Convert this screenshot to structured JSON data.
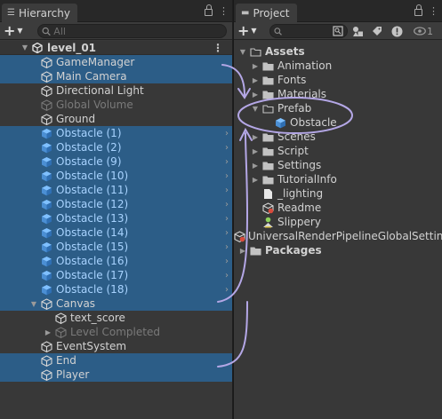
{
  "hierarchy": {
    "tab_label": "Hierarchy",
    "tab_menu": "⋮",
    "search_placeholder": "All",
    "scene_name": "level_01",
    "items": [
      {
        "label": "GameManager",
        "kind": "go",
        "selected": true
      },
      {
        "label": "Main Camera",
        "kind": "go",
        "selected": true
      },
      {
        "label": "Directional Light",
        "kind": "go",
        "selected": false
      },
      {
        "label": "Global Volume",
        "kind": "go",
        "selected": false,
        "dim": true
      },
      {
        "label": "Ground",
        "kind": "go",
        "selected": false
      },
      {
        "label": "Obstacle (1)",
        "kind": "prefab",
        "selected": true
      },
      {
        "label": "Obstacle (2)",
        "kind": "prefab",
        "selected": true
      },
      {
        "label": "Obstacle (9)",
        "kind": "prefab",
        "selected": true
      },
      {
        "label": "Obstacle (10)",
        "kind": "prefab",
        "selected": true
      },
      {
        "label": "Obstacle (11)",
        "kind": "prefab",
        "selected": true
      },
      {
        "label": "Obstacle (12)",
        "kind": "prefab",
        "selected": true
      },
      {
        "label": "Obstacle (13)",
        "kind": "prefab",
        "selected": true
      },
      {
        "label": "Obstacle (14)",
        "kind": "prefab",
        "selected": true
      },
      {
        "label": "Obstacle (15)",
        "kind": "prefab",
        "selected": true
      },
      {
        "label": "Obstacle (16)",
        "kind": "prefab",
        "selected": true
      },
      {
        "label": "Obstacle (17)",
        "kind": "prefab",
        "selected": true
      },
      {
        "label": "Obstacle (18)",
        "kind": "prefab",
        "selected": true
      },
      {
        "label": "Canvas",
        "kind": "go",
        "selected": true,
        "expanded": true
      },
      {
        "label": "text_score",
        "kind": "go",
        "selected": false,
        "child": true
      },
      {
        "label": "Level Completed",
        "kind": "go",
        "selected": false,
        "child": true,
        "dim": true,
        "collapsed": true
      },
      {
        "label": "EventSystem",
        "kind": "go",
        "selected": false
      },
      {
        "label": "End",
        "kind": "go",
        "selected": true
      },
      {
        "label": "Player",
        "kind": "go",
        "selected": true
      }
    ]
  },
  "project": {
    "tab_label": "Project",
    "tab_menu": "⋮",
    "badge": "1",
    "tree": [
      {
        "label": "Assets",
        "level": 0,
        "type": "folder-open",
        "bold": true
      },
      {
        "label": "Animation",
        "level": 1,
        "type": "folder"
      },
      {
        "label": "Fonts",
        "level": 1,
        "type": "folder"
      },
      {
        "label": "Materials",
        "level": 1,
        "type": "folder"
      },
      {
        "label": "Prefab",
        "level": 1,
        "type": "folder-open",
        "expanded": true
      },
      {
        "label": "Obstacle",
        "level": 2,
        "type": "prefab"
      },
      {
        "label": "Scenes",
        "level": 1,
        "type": "folder"
      },
      {
        "label": "Script",
        "level": 1,
        "type": "folder"
      },
      {
        "label": "Settings",
        "level": 1,
        "type": "folder"
      },
      {
        "label": "TutorialInfo",
        "level": 1,
        "type": "folder"
      },
      {
        "label": "_lighting",
        "level": 1,
        "type": "file"
      },
      {
        "label": "Readme",
        "level": 1,
        "type": "readme"
      },
      {
        "label": "Slippery",
        "level": 1,
        "type": "physics"
      },
      {
        "label": "UniversalRenderPipelineGlobalSettings",
        "level": 1,
        "type": "readme"
      },
      {
        "label": "Packages",
        "level": 0,
        "type": "folder",
        "bold": true
      }
    ]
  },
  "annotation_color": "#b4a7e6"
}
